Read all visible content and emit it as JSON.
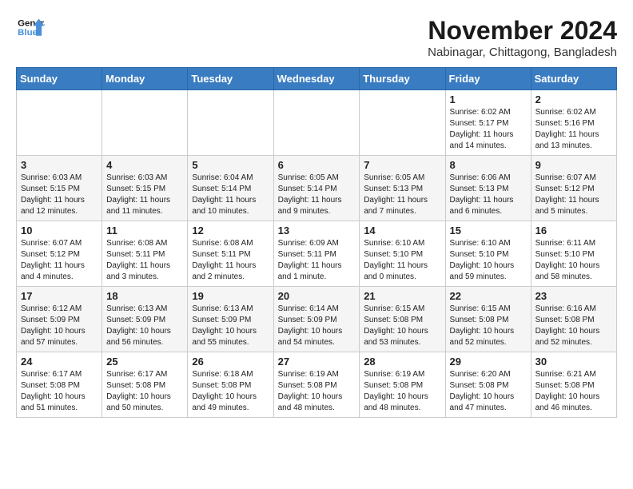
{
  "header": {
    "logo_line1": "General",
    "logo_line2": "Blue",
    "month_title": "November 2024",
    "location": "Nabinagar, Chittagong, Bangladesh"
  },
  "weekdays": [
    "Sunday",
    "Monday",
    "Tuesday",
    "Wednesday",
    "Thursday",
    "Friday",
    "Saturday"
  ],
  "weeks": [
    [
      {
        "day": "",
        "info": ""
      },
      {
        "day": "",
        "info": ""
      },
      {
        "day": "",
        "info": ""
      },
      {
        "day": "",
        "info": ""
      },
      {
        "day": "",
        "info": ""
      },
      {
        "day": "1",
        "info": "Sunrise: 6:02 AM\nSunset: 5:17 PM\nDaylight: 11 hours\nand 14 minutes."
      },
      {
        "day": "2",
        "info": "Sunrise: 6:02 AM\nSunset: 5:16 PM\nDaylight: 11 hours\nand 13 minutes."
      }
    ],
    [
      {
        "day": "3",
        "info": "Sunrise: 6:03 AM\nSunset: 5:15 PM\nDaylight: 11 hours\nand 12 minutes."
      },
      {
        "day": "4",
        "info": "Sunrise: 6:03 AM\nSunset: 5:15 PM\nDaylight: 11 hours\nand 11 minutes."
      },
      {
        "day": "5",
        "info": "Sunrise: 6:04 AM\nSunset: 5:14 PM\nDaylight: 11 hours\nand 10 minutes."
      },
      {
        "day": "6",
        "info": "Sunrise: 6:05 AM\nSunset: 5:14 PM\nDaylight: 11 hours\nand 9 minutes."
      },
      {
        "day": "7",
        "info": "Sunrise: 6:05 AM\nSunset: 5:13 PM\nDaylight: 11 hours\nand 7 minutes."
      },
      {
        "day": "8",
        "info": "Sunrise: 6:06 AM\nSunset: 5:13 PM\nDaylight: 11 hours\nand 6 minutes."
      },
      {
        "day": "9",
        "info": "Sunrise: 6:07 AM\nSunset: 5:12 PM\nDaylight: 11 hours\nand 5 minutes."
      }
    ],
    [
      {
        "day": "10",
        "info": "Sunrise: 6:07 AM\nSunset: 5:12 PM\nDaylight: 11 hours\nand 4 minutes."
      },
      {
        "day": "11",
        "info": "Sunrise: 6:08 AM\nSunset: 5:11 PM\nDaylight: 11 hours\nand 3 minutes."
      },
      {
        "day": "12",
        "info": "Sunrise: 6:08 AM\nSunset: 5:11 PM\nDaylight: 11 hours\nand 2 minutes."
      },
      {
        "day": "13",
        "info": "Sunrise: 6:09 AM\nSunset: 5:11 PM\nDaylight: 11 hours\nand 1 minute."
      },
      {
        "day": "14",
        "info": "Sunrise: 6:10 AM\nSunset: 5:10 PM\nDaylight: 11 hours\nand 0 minutes."
      },
      {
        "day": "15",
        "info": "Sunrise: 6:10 AM\nSunset: 5:10 PM\nDaylight: 10 hours\nand 59 minutes."
      },
      {
        "day": "16",
        "info": "Sunrise: 6:11 AM\nSunset: 5:10 PM\nDaylight: 10 hours\nand 58 minutes."
      }
    ],
    [
      {
        "day": "17",
        "info": "Sunrise: 6:12 AM\nSunset: 5:09 PM\nDaylight: 10 hours\nand 57 minutes."
      },
      {
        "day": "18",
        "info": "Sunrise: 6:13 AM\nSunset: 5:09 PM\nDaylight: 10 hours\nand 56 minutes."
      },
      {
        "day": "19",
        "info": "Sunrise: 6:13 AM\nSunset: 5:09 PM\nDaylight: 10 hours\nand 55 minutes."
      },
      {
        "day": "20",
        "info": "Sunrise: 6:14 AM\nSunset: 5:09 PM\nDaylight: 10 hours\nand 54 minutes."
      },
      {
        "day": "21",
        "info": "Sunrise: 6:15 AM\nSunset: 5:08 PM\nDaylight: 10 hours\nand 53 minutes."
      },
      {
        "day": "22",
        "info": "Sunrise: 6:15 AM\nSunset: 5:08 PM\nDaylight: 10 hours\nand 52 minutes."
      },
      {
        "day": "23",
        "info": "Sunrise: 6:16 AM\nSunset: 5:08 PM\nDaylight: 10 hours\nand 52 minutes."
      }
    ],
    [
      {
        "day": "24",
        "info": "Sunrise: 6:17 AM\nSunset: 5:08 PM\nDaylight: 10 hours\nand 51 minutes."
      },
      {
        "day": "25",
        "info": "Sunrise: 6:17 AM\nSunset: 5:08 PM\nDaylight: 10 hours\nand 50 minutes."
      },
      {
        "day": "26",
        "info": "Sunrise: 6:18 AM\nSunset: 5:08 PM\nDaylight: 10 hours\nand 49 minutes."
      },
      {
        "day": "27",
        "info": "Sunrise: 6:19 AM\nSunset: 5:08 PM\nDaylight: 10 hours\nand 48 minutes."
      },
      {
        "day": "28",
        "info": "Sunrise: 6:19 AM\nSunset: 5:08 PM\nDaylight: 10 hours\nand 48 minutes."
      },
      {
        "day": "29",
        "info": "Sunrise: 6:20 AM\nSunset: 5:08 PM\nDaylight: 10 hours\nand 47 minutes."
      },
      {
        "day": "30",
        "info": "Sunrise: 6:21 AM\nSunset: 5:08 PM\nDaylight: 10 hours\nand 46 minutes."
      }
    ]
  ]
}
